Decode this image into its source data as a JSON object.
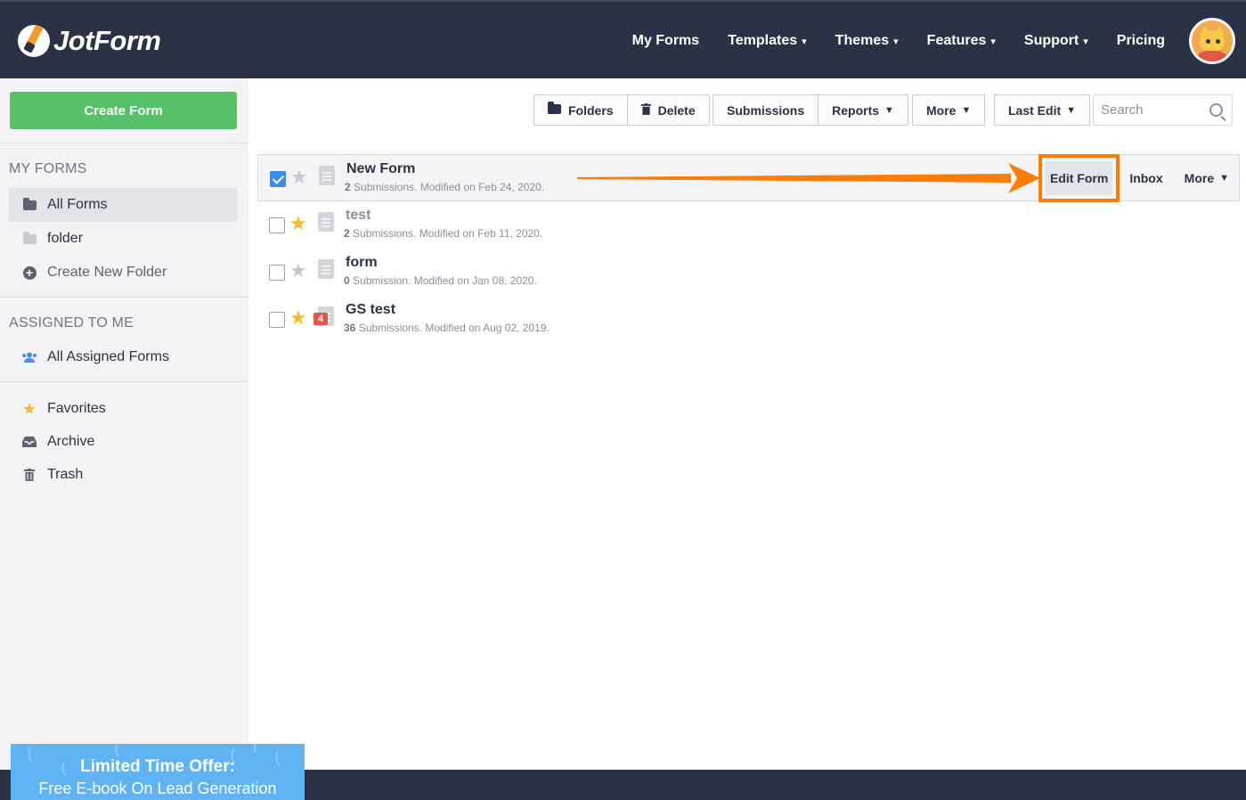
{
  "header": {
    "brand": "JotForm",
    "nav": [
      {
        "label": "My Forms",
        "dropdown": false
      },
      {
        "label": "Templates",
        "dropdown": true
      },
      {
        "label": "Themes",
        "dropdown": true
      },
      {
        "label": "Features",
        "dropdown": true
      },
      {
        "label": "Support",
        "dropdown": true
      },
      {
        "label": "Pricing",
        "dropdown": false
      }
    ],
    "caret": "▾"
  },
  "sidebar": {
    "create_label": "Create Form",
    "my_forms_heading": "MY FORMS",
    "all_forms": "All Forms",
    "folder": "folder",
    "create_folder": "Create New Folder",
    "assigned_heading": "ASSIGNED TO ME",
    "all_assigned": "All Assigned Forms",
    "favorites": "Favorites",
    "archive": "Archive",
    "trash": "Trash"
  },
  "toolbar": {
    "folders": "Folders",
    "delete": "Delete",
    "submissions": "Submissions",
    "reports": "Reports",
    "more": "More",
    "last_edit": "Last Edit",
    "search_placeholder": "Search"
  },
  "forms": [
    {
      "title": "New Form",
      "count": "2",
      "meta": " Submissions. Modified on Feb 24, 2020.",
      "starred": false,
      "checked": true,
      "badge": ""
    },
    {
      "title": "test",
      "count": "2",
      "meta": " Submissions. Modified on Feb 11, 2020.",
      "starred": true,
      "checked": false,
      "badge": ""
    },
    {
      "title": "form",
      "count": "0",
      "meta": " Submission. Modified on Jan 08, 2020.",
      "starred": false,
      "checked": false,
      "badge": ""
    },
    {
      "title": "GS test",
      "count": "36",
      "meta": " Submissions. Modified on Aug 02, 2019.",
      "starred": true,
      "checked": false,
      "badge": "4"
    }
  ],
  "row_actions": {
    "edit": "Edit Form",
    "inbox": "Inbox",
    "more": "More"
  },
  "promo": {
    "line1": "Limited Time Offer:",
    "line2": "Free E-book On Lead Generation"
  },
  "colors": {
    "header_bg": "#2b3245",
    "create_green": "#57c16a",
    "highlight_orange": "#f97d0b",
    "star_gold": "#f9b931",
    "star_grey": "#c6c8ce",
    "check_blue": "#3b8be9"
  }
}
